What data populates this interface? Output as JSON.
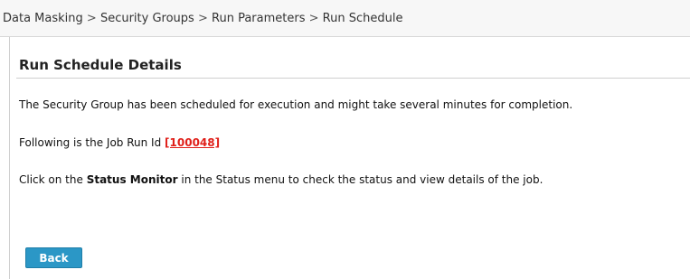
{
  "breadcrumb": {
    "items": [
      "Data Masking",
      "Security Groups",
      "Run Parameters",
      "Run Schedule"
    ],
    "separator": ">"
  },
  "page": {
    "title": "Run Schedule Details"
  },
  "messages": {
    "scheduled": "The Security Group has been scheduled for execution and might take several minutes for completion.",
    "job_prefix": "Following is the Job Run Id",
    "job_id": "[100048]",
    "status_prefix": "Click on the",
    "status_link": "Status Monitor",
    "status_suffix": "in the Status menu to check the status and view details of the job."
  },
  "actions": {
    "back_label": "Back"
  },
  "colors": {
    "button_bg": "#2b97c6",
    "job_id": "#e0201a"
  }
}
